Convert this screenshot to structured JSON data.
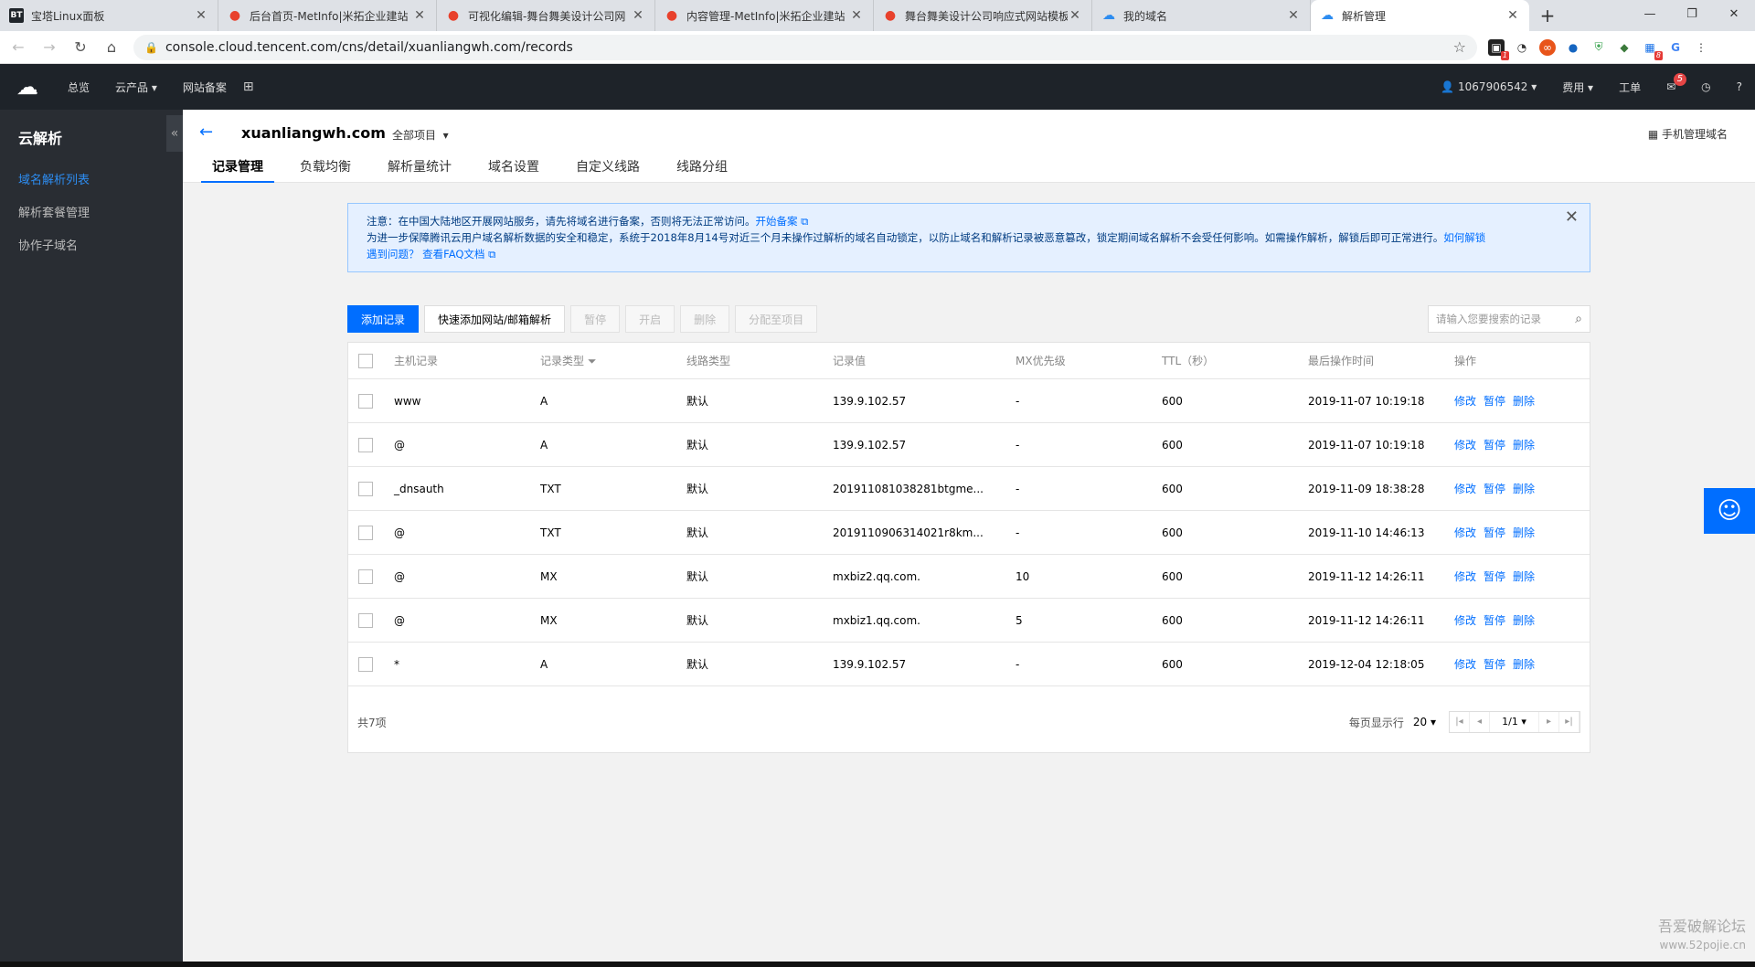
{
  "browser": {
    "tabs": [
      {
        "title": "宝塔Linux面板",
        "icon": "bt"
      },
      {
        "title": "后台首页-MetInfo|米拓企业建站",
        "icon": "met"
      },
      {
        "title": "可视化编辑-舞台舞美设计公司网",
        "icon": "met"
      },
      {
        "title": "内容管理-MetInfo|米拓企业建站",
        "icon": "met"
      },
      {
        "title": "舞台舞美设计公司响应式网站模板",
        "icon": "met"
      },
      {
        "title": "我的域名",
        "icon": "cloud"
      },
      {
        "title": "解析管理",
        "icon": "cloud"
      }
    ],
    "url": "console.cloud.tencent.com/cns/detail/xuanliangwh.com/records",
    "ext_badge_1": "1",
    "ext_badge_2": "8"
  },
  "header": {
    "nav": [
      "总览",
      "云产品 ▾",
      "网站备案"
    ],
    "user": "1067906542 ▾",
    "fee": "费用 ▾",
    "ticket": "工单",
    "mail_count": "5"
  },
  "sidebar": {
    "title": "云解析",
    "items": [
      "域名解析列表",
      "解析套餐管理",
      "协作子域名"
    ]
  },
  "page": {
    "domain": "xuanliangwh.com",
    "project": "全部项目",
    "mobile": "手机管理域名",
    "tabs": [
      "记录管理",
      "负载均衡",
      "解析量统计",
      "域名设置",
      "自定义线路",
      "线路分组"
    ],
    "notice_line1": "注意：在中国大陆地区开展网站服务，请先将域名进行备案，否则将无法正常访问。",
    "notice_link1": "开始备案",
    "notice_line2": "为进一步保障腾讯云用户域名解析数据的安全和稳定，系统于2018年8月14号对近三个月未操作过解析的域名自动锁定，以防止域名和解析记录被恶意篡改，锁定期间域名解析不会受任何影响。如需操作解析，解锁后即可正常进行。",
    "notice_link2": "如何解锁",
    "notice_line3": "遇到问题？",
    "notice_link3": "查看FAQ文档",
    "buttons": {
      "add": "添加记录",
      "quick": "快速添加网站/邮箱解析",
      "pause": "暂停",
      "enable": "开启",
      "delete": "删除",
      "assign": "分配至项目"
    },
    "search_placeholder": "请输入您要搜索的记录"
  },
  "table": {
    "columns": [
      "主机记录",
      "记录类型",
      "线路类型",
      "记录值",
      "MX优先级",
      "TTL（秒）",
      "最后操作时间",
      "操作"
    ],
    "rows": [
      {
        "host": "www",
        "type": "A",
        "line": "默认",
        "value": "139.9.102.57",
        "mx": "-",
        "ttl": "600",
        "time": "2019-11-07 10:19:18"
      },
      {
        "host": "@",
        "type": "A",
        "line": "默认",
        "value": "139.9.102.57",
        "mx": "-",
        "ttl": "600",
        "time": "2019-11-07 10:19:18"
      },
      {
        "host": "_dnsauth",
        "type": "TXT",
        "line": "默认",
        "value": "201911081038281btgme...",
        "mx": "-",
        "ttl": "600",
        "time": "2019-11-09 18:38:28"
      },
      {
        "host": "@",
        "type": "TXT",
        "line": "默认",
        "value": "2019110906314021r8km...",
        "mx": "-",
        "ttl": "600",
        "time": "2019-11-10 14:46:13"
      },
      {
        "host": "@",
        "type": "MX",
        "line": "默认",
        "value": "mxbiz2.qq.com.",
        "mx": "10",
        "ttl": "600",
        "time": "2019-11-12 14:26:11"
      },
      {
        "host": "@",
        "type": "MX",
        "line": "默认",
        "value": "mxbiz1.qq.com.",
        "mx": "5",
        "ttl": "600",
        "time": "2019-11-12 14:26:11"
      },
      {
        "host": "*",
        "type": "A",
        "line": "默认",
        "value": "139.9.102.57",
        "mx": "-",
        "ttl": "600",
        "time": "2019-12-04 12:18:05"
      }
    ],
    "ops": [
      "修改",
      "暂停",
      "删除"
    ],
    "total": "共7项",
    "per_page_label": "每页显示行",
    "per_page": "20",
    "page": "1/1"
  },
  "watermark": {
    "line1": "吾爱破解论坛",
    "line2": "www.52pojie.cn"
  }
}
